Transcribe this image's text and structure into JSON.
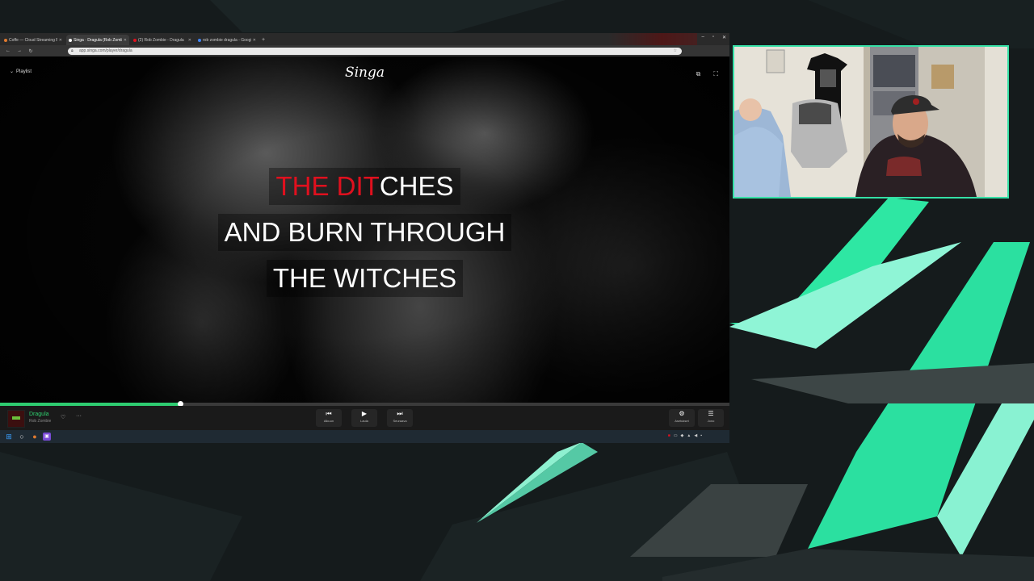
{
  "browser": {
    "tabs": [
      {
        "label": "Coffe — Cloud Streaming Bot",
        "active": false,
        "favicon_color": "#e07a2f"
      },
      {
        "label": "Singa · Dragula (Rob Zombie)",
        "active": true,
        "favicon_color": "#ffffff"
      },
      {
        "label": "(2) Rob Zombie - Dragula",
        "active": false,
        "favicon_color": "#e0101e"
      },
      {
        "label": "rob zombie dragula - Google",
        "active": false,
        "favicon_color": "#4285f4"
      }
    ],
    "url": "app.singa.com/player/dragula",
    "new_tab": "+"
  },
  "player": {
    "queue_label": "Playlist",
    "logo": "Singa",
    "lyrics": {
      "line1_highlighted": "THE DIT",
      "line1_rest": "CHES",
      "line2": "AND BURN THROUGH",
      "line3": "THE WITCHES"
    },
    "progress_fraction": 0.248,
    "song_title": "Dragula",
    "song_artist": "Rob Zombie",
    "buttons": {
      "previous": "Alkuun",
      "play": "Laula",
      "next": "Seuraava",
      "settings": "Asetukset",
      "queue": "Jono"
    }
  },
  "colors": {
    "accent": "#2ecc71",
    "lyric_highlight": "#e0101e",
    "overlay_accent": "#35e0a6"
  }
}
